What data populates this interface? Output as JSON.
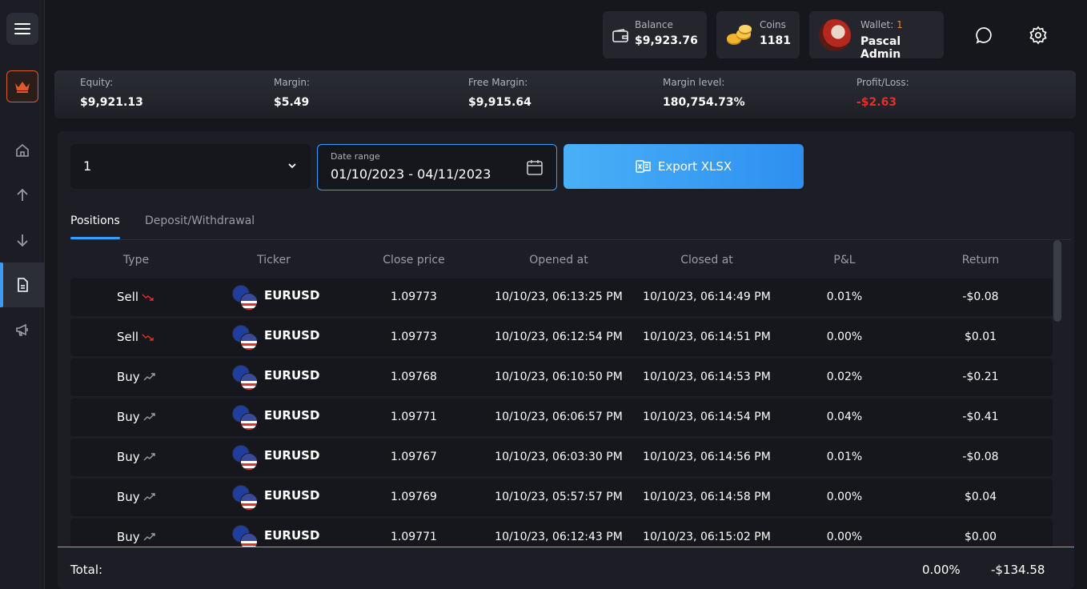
{
  "header": {
    "balance_label": "Balance",
    "balance_value": "$9,923.76",
    "coins_label": "Coins",
    "coins_value": "1181",
    "wallet_label": "Wallet:",
    "wallet_number": "1",
    "user_name": "Pascal Admin"
  },
  "stats": {
    "equity_label": "Equity:",
    "equity_value": "$9,921.13",
    "margin_label": "Margin:",
    "margin_value": "$5.49",
    "free_margin_label": "Free Margin:",
    "free_margin_value": "$9,915.64",
    "margin_level_label": "Margin level:",
    "margin_level_value": "180,754.73%",
    "pl_label": "Profit/Loss:",
    "pl_value": "-$2.63"
  },
  "filters": {
    "account_select": "1",
    "date_label": "Date range",
    "date_value": "01/10/2023 - 04/11/2023",
    "export_label": "Export XLSX"
  },
  "tabs": [
    {
      "label": "Positions"
    },
    {
      "label": "Deposit/Withdrawal"
    }
  ],
  "table": {
    "headers": [
      "Type",
      "Ticker",
      "Close price",
      "Opened at",
      "Closed at",
      "P&L",
      "Return"
    ],
    "rows": [
      {
        "type": "Sell",
        "ticker": "EURUSD",
        "close": "1.09773",
        "opened": "10/10/23, 06:13:25 PM",
        "closed": "10/10/23, 06:14:49 PM",
        "pl": "0.01%",
        "ret": "-$0.08"
      },
      {
        "type": "Sell",
        "ticker": "EURUSD",
        "close": "1.09773",
        "opened": "10/10/23, 06:12:54 PM",
        "closed": "10/10/23, 06:14:51 PM",
        "pl": "0.00%",
        "ret": "$0.01"
      },
      {
        "type": "Buy",
        "ticker": "EURUSD",
        "close": "1.09768",
        "opened": "10/10/23, 06:10:50 PM",
        "closed": "10/10/23, 06:14:53 PM",
        "pl": "0.02%",
        "ret": "-$0.21"
      },
      {
        "type": "Buy",
        "ticker": "EURUSD",
        "close": "1.09771",
        "opened": "10/10/23, 06:06:57 PM",
        "closed": "10/10/23, 06:14:54 PM",
        "pl": "0.04%",
        "ret": "-$0.41"
      },
      {
        "type": "Buy",
        "ticker": "EURUSD",
        "close": "1.09767",
        "opened": "10/10/23, 06:03:30 PM",
        "closed": "10/10/23, 06:14:56 PM",
        "pl": "0.01%",
        "ret": "-$0.08"
      },
      {
        "type": "Buy",
        "ticker": "EURUSD",
        "close": "1.09769",
        "opened": "10/10/23, 05:57:57 PM",
        "closed": "10/10/23, 06:14:58 PM",
        "pl": "0.00%",
        "ret": "$0.04"
      },
      {
        "type": "Buy",
        "ticker": "EURUSD",
        "close": "1.09771",
        "opened": "10/10/23, 06:12:43 PM",
        "closed": "10/10/23, 06:15:02 PM",
        "pl": "0.00%",
        "ret": "$0.00"
      }
    ]
  },
  "footer": {
    "total_label": "Total:",
    "total_pl": "0.00%",
    "total_return": "-$134.58"
  },
  "icons": {
    "menu": "menu-icon",
    "crown": "crown-icon",
    "home": "home-icon",
    "deposit": "arrow-up-icon",
    "withdraw": "arrow-down-icon",
    "history": "document-icon",
    "promo": "megaphone-icon",
    "chat": "chat-icon",
    "settings": "gear-icon"
  },
  "colors": {
    "accent": "#3b9cf5",
    "loss": "#e0312b",
    "brand": "#e05a2b"
  }
}
